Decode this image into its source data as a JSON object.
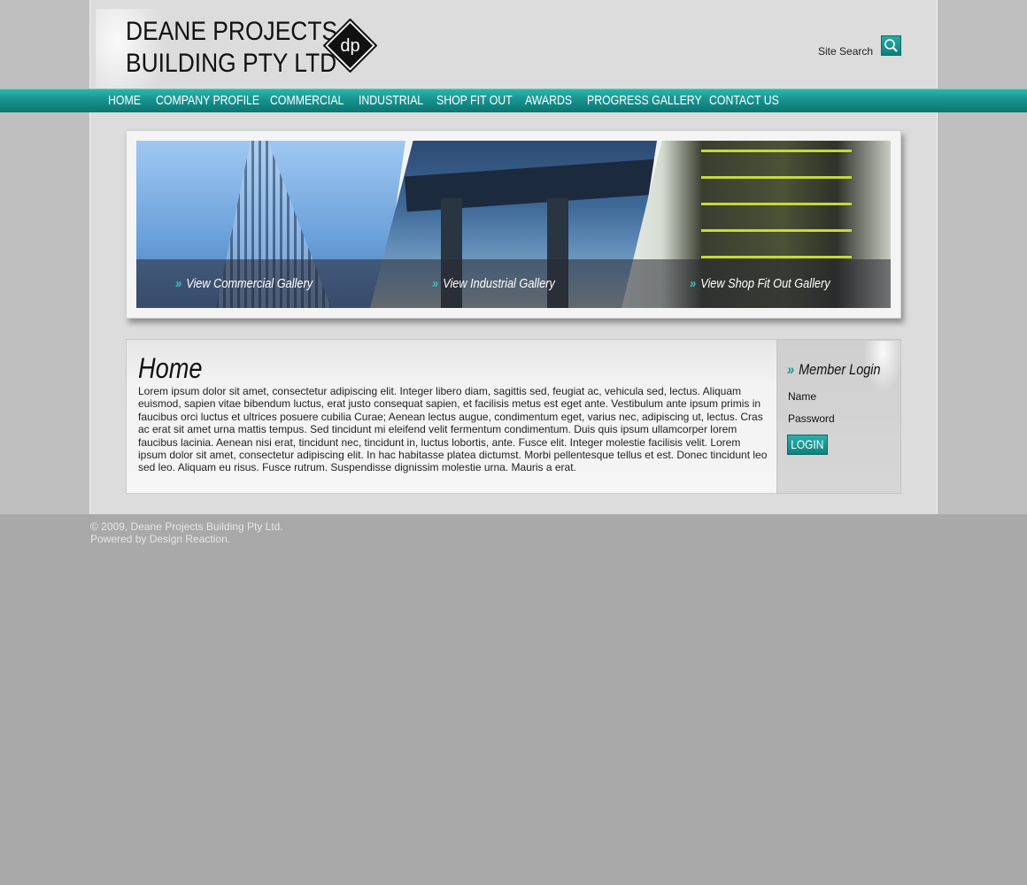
{
  "header": {
    "company_line1": "DEANE PROJECTS",
    "company_line2": "BUILDING PTY LTD",
    "logo_monogram": "dp",
    "site_search_label": "Site Search",
    "search_icon": "search-icon"
  },
  "nav": {
    "items": [
      "HOME",
      "COMPANY PROFILE",
      "COMMERCIAL",
      "INDUSTRIAL",
      "SHOP FIT OUT",
      "AWARDS",
      "PROGRESS GALLERY",
      "CONTACT US"
    ]
  },
  "gallery": {
    "chevron": "»",
    "links": [
      "View Commercial Gallery",
      "View Industrial Gallery",
      "View Shop Fit Out Gallery"
    ]
  },
  "main": {
    "title": "Home",
    "body": "Lorem ipsum dolor sit amet, consectetur adipiscing elit. Integer libero diam, sagittis sed, feugiat ac, vehicula sed, lectus. Aliquam euismod, sapien vitae bibendum luctus, erat justo consequat sapien, et facilisis metus est eget ante. Vestibulum ante ipsum primis in faucibus orci luctus et ultrices posuere cubilia Curae; Aenean lectus augue, condimentum eget, varius nec, adipiscing ut, lectus. Cras ac erat sit amet urna mattis tempus. Sed tincidunt mi eleifend velit fermentum condimentum. Duis quis ipsum ullamcorper lorem faucibus lacinia. Aenean nisi erat, tincidunt nec, tincidunt in, luctus lobortis, ante. Fusce elit. Integer molestie facilisis velit. Lorem ipsum dolor sit amet, consectetur adipiscing elit. In hac habitasse platea dictumst. Morbi pellentesque tellus et est. Donec tincidunt leo sed leo. Aliquam eu risus. Fusce rutrum. Suspendisse dignissim molestie urna. Mauris a erat."
  },
  "login": {
    "chevron": "»",
    "title": "Member Login",
    "name_label": "Name",
    "password_label": "Password",
    "button_label": "LOGIN"
  },
  "footer": {
    "copyright": "© 2009, Deane Projects Building Pty Ltd.",
    "powered": "Powered by Design Reaction."
  },
  "colors": {
    "accent": "#17938f",
    "background": "#a9a9a9",
    "page": "#dcdcdc"
  }
}
